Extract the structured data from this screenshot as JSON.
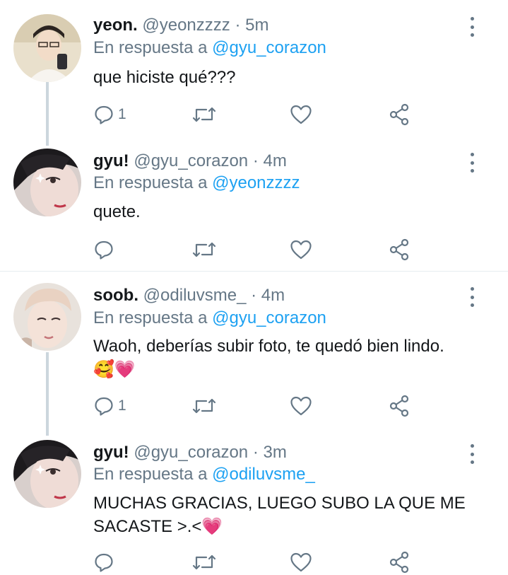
{
  "tweets": [
    {
      "name": "yeon.",
      "handle": "@yeonzzzz",
      "separator": "·",
      "time": "5m",
      "reply_prefix": "En respuesta a",
      "reply_to": "@gyu_corazon",
      "text": "que hiciste qué???",
      "emoji_line": "",
      "reply_count": "1"
    },
    {
      "name": "gyu!",
      "handle": "@gyu_corazon",
      "separator": "·",
      "time": "4m",
      "reply_prefix": "En respuesta a",
      "reply_to": "@yeonzzzz",
      "text": "quete.",
      "emoji_line": "",
      "reply_count": ""
    },
    {
      "name": "soob.",
      "handle": "@odiluvsme_",
      "separator": "·",
      "time": "4m",
      "reply_prefix": "En respuesta a",
      "reply_to": "@gyu_corazon",
      "text": "Waoh, deberías subir foto, te quedó bien lindo.",
      "emoji_line": "🥰💗",
      "reply_count": "1"
    },
    {
      "name": "gyu!",
      "handle": "@gyu_corazon",
      "separator": "·",
      "time": "3m",
      "reply_prefix": "En respuesta a",
      "reply_to": "@odiluvsme_",
      "text": "MUCHAS GRACIAS, LUEGO SUBO LA QUE ME SACASTE >.<",
      "emoji_line": "💗",
      "reply_count": ""
    }
  ],
  "icons": {
    "reply": "reply-icon",
    "retweet": "retweet-icon",
    "like": "heart-icon",
    "share": "share-icon",
    "more": "more-vertical-icon"
  },
  "colors": {
    "text": "#14171a",
    "secondary": "#657786",
    "mention": "#1da1f2",
    "thread_line": "#ccd6dd",
    "divider": "#e6ecf0"
  }
}
